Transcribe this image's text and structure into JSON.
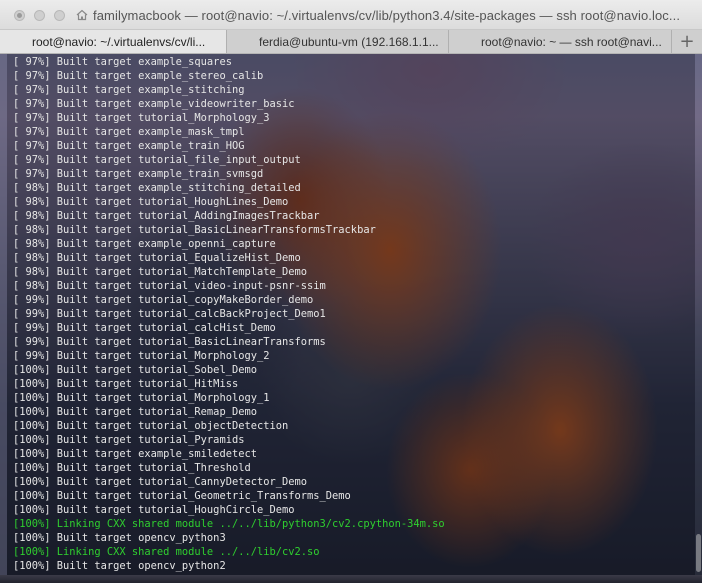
{
  "window": {
    "title": "familymacbook — root@navio: ~/.virtualenvs/cv/lib/python3.4/site-packages — ssh root@navio.loc..."
  },
  "tabs": [
    {
      "label": "root@navio: ~/.virtualenvs/cv/li...",
      "active": true
    },
    {
      "label": "ferdia@ubuntu-vm (192.168.1.1...",
      "active": false
    },
    {
      "label": "root@navio: ~ — ssh root@navi...",
      "active": false
    }
  ],
  "new_tab_symbol": "+",
  "terminal": {
    "text_color": "#e6e6e6",
    "highlight_color": "#2fcf2f",
    "lines": [
      {
        "text": "[ 97%] Built target example_squares",
        "green": false
      },
      {
        "text": "[ 97%] Built target example_stereo_calib",
        "green": false
      },
      {
        "text": "[ 97%] Built target example_stitching",
        "green": false
      },
      {
        "text": "[ 97%] Built target example_videowriter_basic",
        "green": false
      },
      {
        "text": "[ 97%] Built target tutorial_Morphology_3",
        "green": false
      },
      {
        "text": "[ 97%] Built target example_mask_tmpl",
        "green": false
      },
      {
        "text": "[ 97%] Built target example_train_HOG",
        "green": false
      },
      {
        "text": "[ 97%] Built target tutorial_file_input_output",
        "green": false
      },
      {
        "text": "[ 97%] Built target example_train_svmsgd",
        "green": false
      },
      {
        "text": "[ 98%] Built target example_stitching_detailed",
        "green": false
      },
      {
        "text": "[ 98%] Built target tutorial_HoughLines_Demo",
        "green": false
      },
      {
        "text": "[ 98%] Built target tutorial_AddingImagesTrackbar",
        "green": false
      },
      {
        "text": "[ 98%] Built target tutorial_BasicLinearTransformsTrackbar",
        "green": false
      },
      {
        "text": "[ 98%] Built target example_openni_capture",
        "green": false
      },
      {
        "text": "[ 98%] Built target tutorial_EqualizeHist_Demo",
        "green": false
      },
      {
        "text": "[ 98%] Built target tutorial_MatchTemplate_Demo",
        "green": false
      },
      {
        "text": "[ 98%] Built target tutorial_video-input-psnr-ssim",
        "green": false
      },
      {
        "text": "[ 99%] Built target tutorial_copyMakeBorder_demo",
        "green": false
      },
      {
        "text": "[ 99%] Built target tutorial_calcBackProject_Demo1",
        "green": false
      },
      {
        "text": "[ 99%] Built target tutorial_calcHist_Demo",
        "green": false
      },
      {
        "text": "[ 99%] Built target tutorial_BasicLinearTransforms",
        "green": false
      },
      {
        "text": "[ 99%] Built target tutorial_Morphology_2",
        "green": false
      },
      {
        "text": "[100%] Built target tutorial_Sobel_Demo",
        "green": false
      },
      {
        "text": "[100%] Built target tutorial_HitMiss",
        "green": false
      },
      {
        "text": "[100%] Built target tutorial_Morphology_1",
        "green": false
      },
      {
        "text": "[100%] Built target tutorial_Remap_Demo",
        "green": false
      },
      {
        "text": "[100%] Built target tutorial_objectDetection",
        "green": false
      },
      {
        "text": "[100%] Built target tutorial_Pyramids",
        "green": false
      },
      {
        "text": "[100%] Built target example_smiledetect",
        "green": false
      },
      {
        "text": "[100%] Built target tutorial_Threshold",
        "green": false
      },
      {
        "text": "[100%] Built target tutorial_CannyDetector_Demo",
        "green": false
      },
      {
        "text": "[100%] Built target tutorial_Geometric_Transforms_Demo",
        "green": false
      },
      {
        "text": "[100%] Built target tutorial_HoughCircle_Demo",
        "green": false
      },
      {
        "text": "[100%] Linking CXX shared module ../../lib/python3/cv2.cpython-34m.so",
        "green": true
      },
      {
        "text": "[100%] Built target opencv_python3",
        "green": false
      },
      {
        "text": "[100%] Linking CXX shared module ../../lib/cv2.so",
        "green": true
      },
      {
        "text": "[100%] Built target opencv_python2",
        "green": false
      }
    ]
  }
}
